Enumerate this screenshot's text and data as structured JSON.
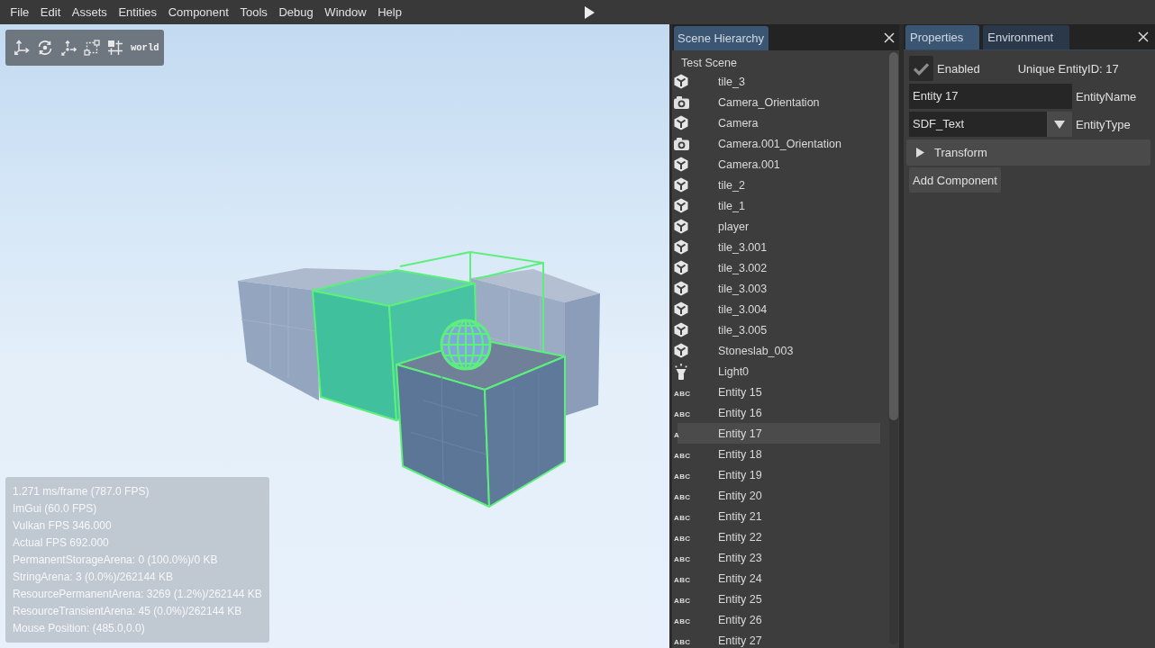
{
  "menu_bar": {
    "items": [
      "File",
      "Edit",
      "Assets",
      "Entities",
      "Component",
      "Tools",
      "Debug",
      "Window",
      "Help"
    ]
  },
  "viewport": {
    "toolbar": {
      "tools": [
        {
          "kind": "translate"
        },
        {
          "kind": "rotate"
        },
        {
          "kind": "scale"
        },
        {
          "kind": "bounds"
        },
        {
          "kind": "snap"
        }
      ],
      "space": "world"
    },
    "stats": [
      "1.271 ms/frame (787.0 FPS)",
      "ImGui (60.0 FPS)",
      "Vulkan FPS 346.000",
      "Actual FPS 692.000",
      "PermanentStorageArena: 0 (100.0%)/0 KB",
      "StringArena: 3 (0.0%)/262144 KB",
      "ResourcePermanentArena: 3269 (1.2%)/262144 KB",
      "ResourceTransientArena: 45 (0.0%)/262144 KB",
      "Mouse Position: (485.0,0.0)"
    ]
  },
  "hierarchy_panel": {
    "tabs": [
      {
        "label": "Scene Hierarchy",
        "selected": true
      }
    ],
    "tree": {
      "label": "Test Scene",
      "children": [
        {
          "label": "tile_3",
          "kind": "mesh",
          "selected": false
        },
        {
          "label": "Camera_Orientation",
          "kind": "camera",
          "selected": false
        },
        {
          "label": "Camera",
          "kind": "mesh",
          "selected": false
        },
        {
          "label": "Camera.001_Orientation",
          "kind": "camera",
          "selected": false
        },
        {
          "label": "Camera.001",
          "kind": "mesh",
          "selected": false
        },
        {
          "label": "tile_2",
          "kind": "mesh",
          "selected": false
        },
        {
          "label": "tile_1",
          "kind": "mesh",
          "selected": false
        },
        {
          "label": "player",
          "kind": "mesh",
          "selected": false
        },
        {
          "label": "tile_3.001",
          "kind": "mesh",
          "selected": false
        },
        {
          "label": "tile_3.002",
          "kind": "mesh",
          "selected": false
        },
        {
          "label": "tile_3.003",
          "kind": "mesh",
          "selected": false
        },
        {
          "label": "tile_3.004",
          "kind": "mesh",
          "selected": false
        },
        {
          "label": "tile_3.005",
          "kind": "mesh",
          "selected": false
        },
        {
          "label": "Stoneslab_003",
          "kind": "mesh",
          "selected": false
        },
        {
          "label": "Light0",
          "kind": "light",
          "selected": false
        },
        {
          "label": "Entity 15",
          "kind": "text",
          "glyph": "ABC",
          "selected": false
        },
        {
          "label": "Entity 16",
          "kind": "text",
          "glyph": "ABC",
          "selected": false
        },
        {
          "label": "Entity 17",
          "kind": "text",
          "glyph": "A",
          "selected": true
        },
        {
          "label": "Entity 18",
          "kind": "text",
          "glyph": "ABC",
          "selected": false
        },
        {
          "label": "Entity 19",
          "kind": "text",
          "glyph": "ABC",
          "selected": false
        },
        {
          "label": "Entity 20",
          "kind": "text",
          "glyph": "ABC",
          "selected": false
        },
        {
          "label": "Entity 21",
          "kind": "text",
          "glyph": "ABC",
          "selected": false
        },
        {
          "label": "Entity 22",
          "kind": "text",
          "glyph": "ABC",
          "selected": false
        },
        {
          "label": "Entity 23",
          "kind": "text",
          "glyph": "ABC",
          "selected": false
        },
        {
          "label": "Entity 24",
          "kind": "text",
          "glyph": "ABC",
          "selected": false
        },
        {
          "label": "Entity 25",
          "kind": "text",
          "glyph": "ABC",
          "selected": false
        },
        {
          "label": "Entity 26",
          "kind": "text",
          "glyph": "ABC",
          "selected": false
        },
        {
          "label": "Entity 27",
          "kind": "text",
          "glyph": "ABC",
          "selected": false
        }
      ]
    }
  },
  "properties_panel": {
    "tabs": [
      {
        "label": "Properties",
        "selected": true
      },
      {
        "label": "Environment",
        "selected": false
      }
    ],
    "enabled": {
      "label": "Enabled",
      "checked": true
    },
    "entity_id": "Unique EntityID: 17",
    "name_field": {
      "value": "Entity 17",
      "label": "EntityName"
    },
    "type_field": {
      "value": "SDF_Text",
      "label": "EntityType"
    },
    "sections": [
      {
        "label": "Transform",
        "expanded": false
      }
    ],
    "add_button": "Add Component"
  }
}
